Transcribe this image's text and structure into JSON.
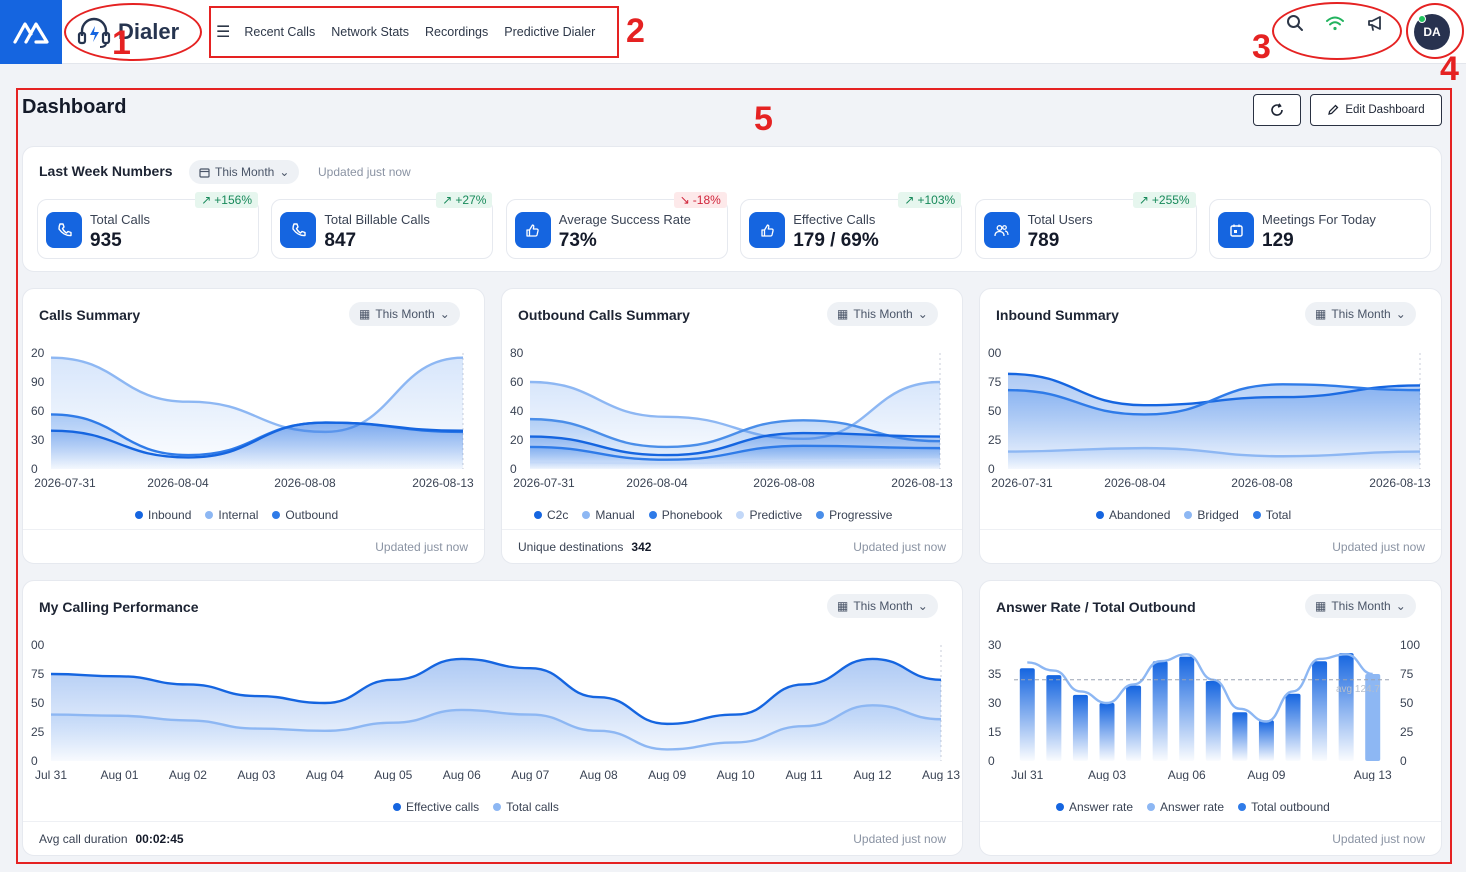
{
  "brand": {
    "name": "Dialer"
  },
  "nav": {
    "items": [
      "Recent Calls",
      "Network Stats",
      "Recordings",
      "Predictive Dialer"
    ]
  },
  "user": {
    "initials": "DA"
  },
  "annotations": [
    "1",
    "2",
    "3",
    "4",
    "5"
  ],
  "dashboard": {
    "title": "Dashboard",
    "edit_label": "Edit Dashboard",
    "last_week": {
      "title": "Last Week Numbers",
      "period": "This Month",
      "updated": "Updated just now",
      "kpis": [
        {
          "label": "Total Calls",
          "value": "935",
          "change": "+156%",
          "direction": "up",
          "icon": "phone-icon"
        },
        {
          "label": "Total Billable Calls",
          "value": "847",
          "change": "+27%",
          "direction": "up",
          "icon": "phone-icon"
        },
        {
          "label": "Average Success Rate",
          "value": "73%",
          "change": "-18%",
          "direction": "down",
          "icon": "thumbs-up-icon"
        },
        {
          "label": "Effective Calls",
          "value": "179 / 69%",
          "change": "+103%",
          "direction": "up",
          "icon": "thumbs-up-icon"
        },
        {
          "label": "Total Users",
          "value": "789",
          "change": "+255%",
          "direction": "up",
          "icon": "users-icon"
        },
        {
          "label": "Meetings For Today",
          "value": "129",
          "change": "",
          "direction": "none",
          "icon": "calendar-icon"
        }
      ]
    },
    "calls_summary": {
      "title": "Calls Summary",
      "period": "This Month",
      "updated": "Updated just now"
    },
    "outbound_summary": {
      "title": "Outbound Calls Summary",
      "period": "This Month",
      "updated": "Updated just now",
      "footer_label": "Unique destinations",
      "footer_value": "342"
    },
    "inbound_summary": {
      "title": "Inbound Summary",
      "period": "This Month",
      "updated": "Updated just now"
    },
    "performance": {
      "title": "My Calling Performance",
      "period": "This Month",
      "updated": "Updated just now",
      "footer_label": "Avg call duration",
      "footer_value": "00:02:45"
    },
    "answer_rate": {
      "title": "Answer Rate / Total Outbound",
      "period": "This Month",
      "updated": "Updated just now",
      "avg_label": "avg 124.7"
    }
  },
  "colors": {
    "primary": "#1565e0",
    "mid": "#5b9bf0",
    "light": "#a8c8f7",
    "pale": "#c8dcf9"
  },
  "chart_data": [
    {
      "type": "area",
      "title": "Calls Summary",
      "x": [
        "2026-07-31",
        "2026-08-04",
        "2026-08-08",
        "2026-08-13"
      ],
      "y_ticks": [
        "20",
        "90",
        "60",
        "30",
        "0"
      ],
      "series": [
        {
          "name": "Inbound",
          "color": "#1565e0",
          "values": [
            33,
            10,
            40,
            33
          ]
        },
        {
          "name": "Internal",
          "color": "#8db7f3",
          "values": [
            96,
            58,
            32,
            96
          ]
        },
        {
          "name": "Outbound",
          "color": "#2f7be8",
          "values": [
            47,
            12,
            40,
            32
          ]
        }
      ]
    },
    {
      "type": "area",
      "title": "Outbound Calls Summary",
      "x": [
        "2026-07-31",
        "2026-08-04",
        "2026-08-08",
        "2026-08-13"
      ],
      "y_ticks": [
        "80",
        "60",
        "40",
        "20",
        "0"
      ],
      "series": [
        {
          "name": "C2c",
          "color": "#1565e0",
          "values": [
            28,
            12,
            31,
            28
          ]
        },
        {
          "name": "Manual",
          "color": "#8db7f3",
          "values": [
            75,
            45,
            26,
            75
          ]
        },
        {
          "name": "Phonebook",
          "color": "#2f7be8",
          "values": [
            19,
            8,
            20,
            18
          ]
        },
        {
          "name": "Predictive",
          "color": "#c3d8f8",
          "values": [
            6,
            5,
            7,
            8
          ]
        },
        {
          "name": "Progressive",
          "color": "#4a8ee9",
          "values": [
            43,
            19,
            42,
            24
          ]
        }
      ]
    },
    {
      "type": "area",
      "title": "Inbound Summary",
      "x": [
        "2026-07-31",
        "2026-08-04",
        "2026-08-08",
        "2026-08-13"
      ],
      "y_ticks": [
        "00",
        "75",
        "50",
        "25",
        "0"
      ],
      "series": [
        {
          "name": "Abandoned",
          "color": "#1565e0",
          "values": [
            82,
            55,
            62,
            72
          ]
        },
        {
          "name": "Bridged",
          "color": "#8db7f3",
          "values": [
            15,
            18,
            11,
            15
          ]
        },
        {
          "name": "Total",
          "color": "#2f7be8",
          "values": [
            68,
            47,
            73,
            68
          ]
        }
      ]
    },
    {
      "type": "area",
      "title": "My Calling Performance",
      "x": [
        "Jul 31",
        "Aug 01",
        "Aug 02",
        "Aug 03",
        "Aug 04",
        "Aug 05",
        "Aug 06",
        "Aug 07",
        "Aug 08",
        "Aug 09",
        "Aug 10",
        "Aug 11",
        "Aug 12",
        "Aug 13"
      ],
      "y_ticks": [
        "00",
        "75",
        "50",
        "25",
        "0"
      ],
      "series": [
        {
          "name": "Effective calls",
          "color": "#1565e0",
          "values": [
            75,
            73,
            66,
            56,
            50,
            70,
            88,
            80,
            55,
            32,
            40,
            66,
            88,
            70
          ]
        },
        {
          "name": "Total calls",
          "color": "#8db7f3",
          "values": [
            40,
            39,
            35,
            28,
            26,
            33,
            44,
            40,
            26,
            10,
            16,
            30,
            48,
            36
          ]
        }
      ]
    },
    {
      "type": "bar",
      "title": "Answer Rate / Total Outbound",
      "categories": [
        "Jul 31",
        "Aug 01",
        "Aug 02",
        "Aug 03",
        "Aug 04",
        "Aug 05",
        "Aug 06",
        "Aug 07",
        "Aug 08",
        "Aug 09",
        "Aug 10",
        "Aug 11",
        "Aug 12",
        "Aug 13"
      ],
      "x_ticks": [
        "Jul 31",
        "Aug 03",
        "Aug 06",
        "Aug 09",
        "Aug 13"
      ],
      "y_left_ticks": [
        "30",
        "35",
        "30",
        "15",
        "0"
      ],
      "y_right_ticks": [
        "100",
        "75",
        "50",
        "25",
        "0"
      ],
      "avg": 124.7,
      "series": [
        {
          "name": "Answer rate",
          "color": "#1565e0",
          "values": [
            80,
            74,
            57,
            50,
            65,
            86,
            90,
            69,
            42,
            35,
            58,
            86,
            93,
            75
          ]
        },
        {
          "name": "Answer rate",
          "color": "#8db7f3",
          "values": [
            85,
            78,
            60,
            50,
            66,
            86,
            92,
            70,
            45,
            34,
            60,
            88,
            92,
            75
          ]
        },
        {
          "name": "Total outbound",
          "color": "#2f7be8",
          "values": [
            80,
            74,
            57,
            50,
            65,
            86,
            90,
            69,
            42,
            35,
            58,
            86,
            93,
            75
          ]
        }
      ]
    }
  ]
}
